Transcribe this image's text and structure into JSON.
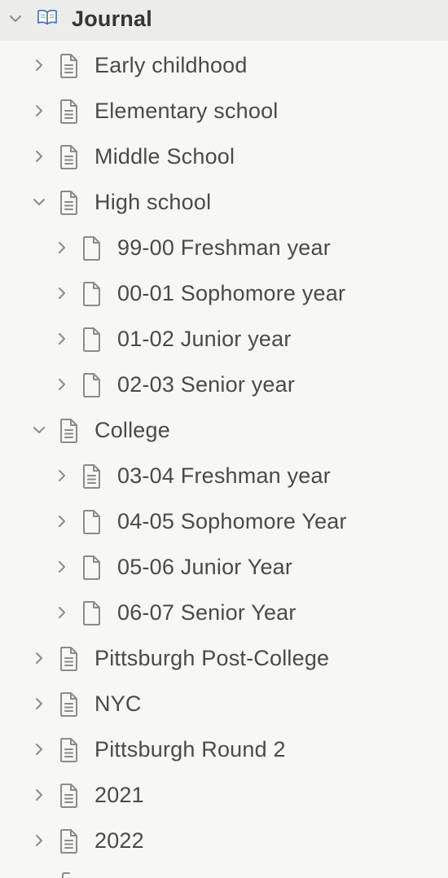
{
  "root": {
    "label": "Journal",
    "expanded": true,
    "icon": "open-book-icon"
  },
  "items": [
    {
      "label": "Early childhood",
      "level": 1,
      "expanded": false,
      "icon": "page-lines-icon"
    },
    {
      "label": "Elementary school",
      "level": 1,
      "expanded": false,
      "icon": "page-lines-icon"
    },
    {
      "label": "Middle School",
      "level": 1,
      "expanded": false,
      "icon": "page-lines-icon"
    },
    {
      "label": "High school",
      "level": 1,
      "expanded": true,
      "icon": "page-lines-icon"
    },
    {
      "label": "99-00 Freshman year",
      "level": 2,
      "expanded": false,
      "icon": "page-blank-icon"
    },
    {
      "label": "00-01 Sophomore year",
      "level": 2,
      "expanded": false,
      "icon": "page-blank-icon"
    },
    {
      "label": "01-02 Junior year",
      "level": 2,
      "expanded": false,
      "icon": "page-blank-icon"
    },
    {
      "label": "02-03 Senior year",
      "level": 2,
      "expanded": false,
      "icon": "page-blank-icon"
    },
    {
      "label": "College",
      "level": 1,
      "expanded": true,
      "icon": "page-lines-icon"
    },
    {
      "label": "03-04 Freshman year",
      "level": 2,
      "expanded": false,
      "icon": "page-lines-icon"
    },
    {
      "label": "04-05 Sophomore Year",
      "level": 2,
      "expanded": false,
      "icon": "page-blank-icon"
    },
    {
      "label": "05-06 Junior Year",
      "level": 2,
      "expanded": false,
      "icon": "page-blank-icon"
    },
    {
      "label": "06-07 Senior Year",
      "level": 2,
      "expanded": false,
      "icon": "page-blank-icon"
    },
    {
      "label": "Pittsburgh Post-College",
      "level": 1,
      "expanded": false,
      "icon": "page-lines-icon"
    },
    {
      "label": "NYC",
      "level": 1,
      "expanded": false,
      "icon": "page-lines-icon"
    },
    {
      "label": "Pittsburgh Round 2",
      "level": 1,
      "expanded": false,
      "icon": "page-lines-icon"
    },
    {
      "label": "2021",
      "level": 1,
      "expanded": false,
      "icon": "page-lines-icon"
    },
    {
      "label": "2022",
      "level": 1,
      "expanded": false,
      "icon": "page-lines-icon"
    }
  ],
  "colors": {
    "background": "#f7f7f5",
    "root_highlight": "#ececea",
    "text": "#4a4a48",
    "icon": "#8c8b87"
  }
}
